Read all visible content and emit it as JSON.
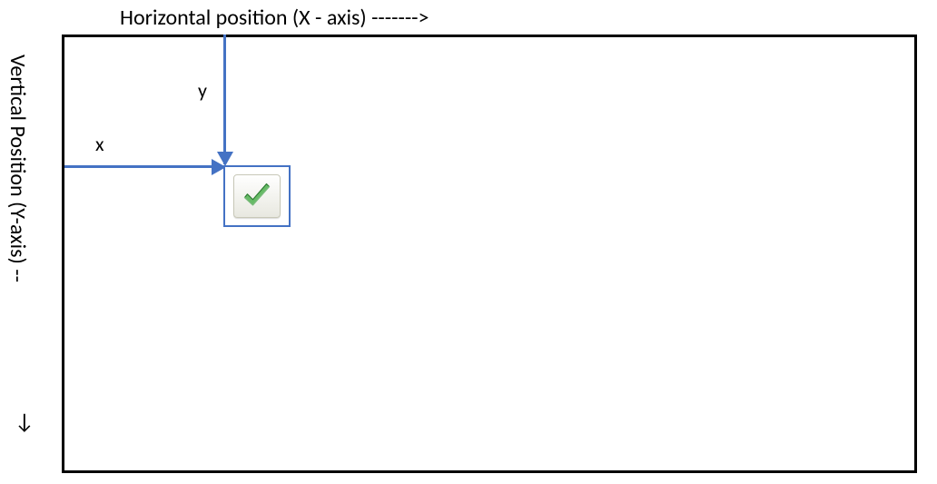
{
  "labels": {
    "x_axis_title": "Horizontal position (X - axis) ------->",
    "y_axis_title": "Vertical Position (Y-axis)   --",
    "y_axis_title_arrow_suffix": "↓",
    "x_marker": "x",
    "y_marker": "y"
  },
  "colors": {
    "arrow": "#4472C4",
    "box_border": "#000000",
    "element_border": "#4472C4",
    "check_fill": "#5fb25f",
    "check_dark": "#2e7d32"
  },
  "icon": {
    "name": "checkmark-icon"
  }
}
